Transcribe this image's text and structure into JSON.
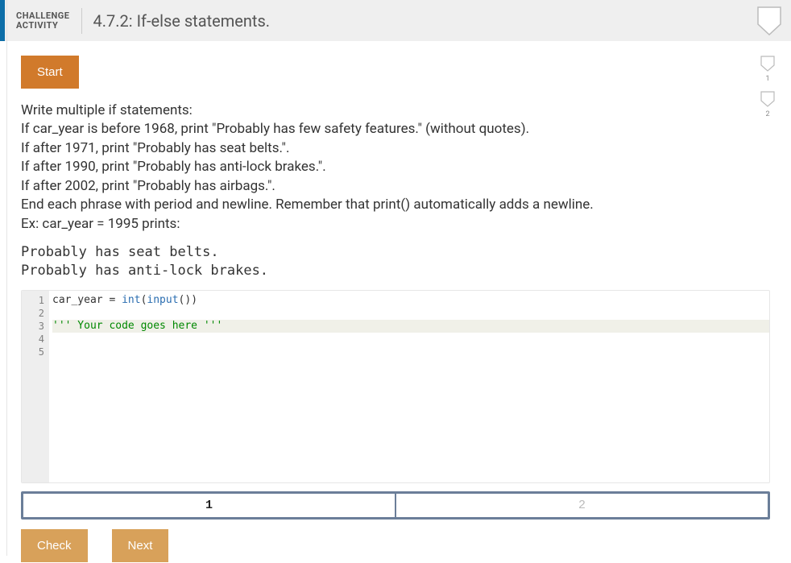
{
  "header": {
    "label_line1": "CHALLENGE",
    "label_line2": "ACTIVITY",
    "title": "4.7.2: If-else statements."
  },
  "buttons": {
    "start": "Start",
    "check": "Check",
    "next": "Next"
  },
  "side_badges": [
    "1",
    "2"
  ],
  "instructions": {
    "lines": [
      "Write multiple if statements:",
      "If car_year is before 1968, print \"Probably has few safety features.\" (without quotes).",
      "If after 1971, print \"Probably has seat belts.\".",
      "If after 1990, print \"Probably has anti-lock brakes.\".",
      "If after 2002, print \"Probably has airbags.\".",
      "End each phrase with period and newline. Remember that print() automatically adds a newline.",
      "Ex: car_year = 1995 prints:"
    ],
    "example_output": "Probably has seat belts.\nProbably has anti-lock brakes."
  },
  "editor": {
    "line_numbers": [
      "1",
      "2",
      "3",
      "4",
      "5"
    ],
    "lines": {
      "l1_pre": "car_year = ",
      "l1_fn1": "int",
      "l1_mid": "(",
      "l1_fn2": "input",
      "l1_post": "())",
      "l2": "",
      "l3": "''' Your code goes here '''",
      "l4": "",
      "l5": ""
    }
  },
  "steps": {
    "step1": "1",
    "step2": "2"
  }
}
